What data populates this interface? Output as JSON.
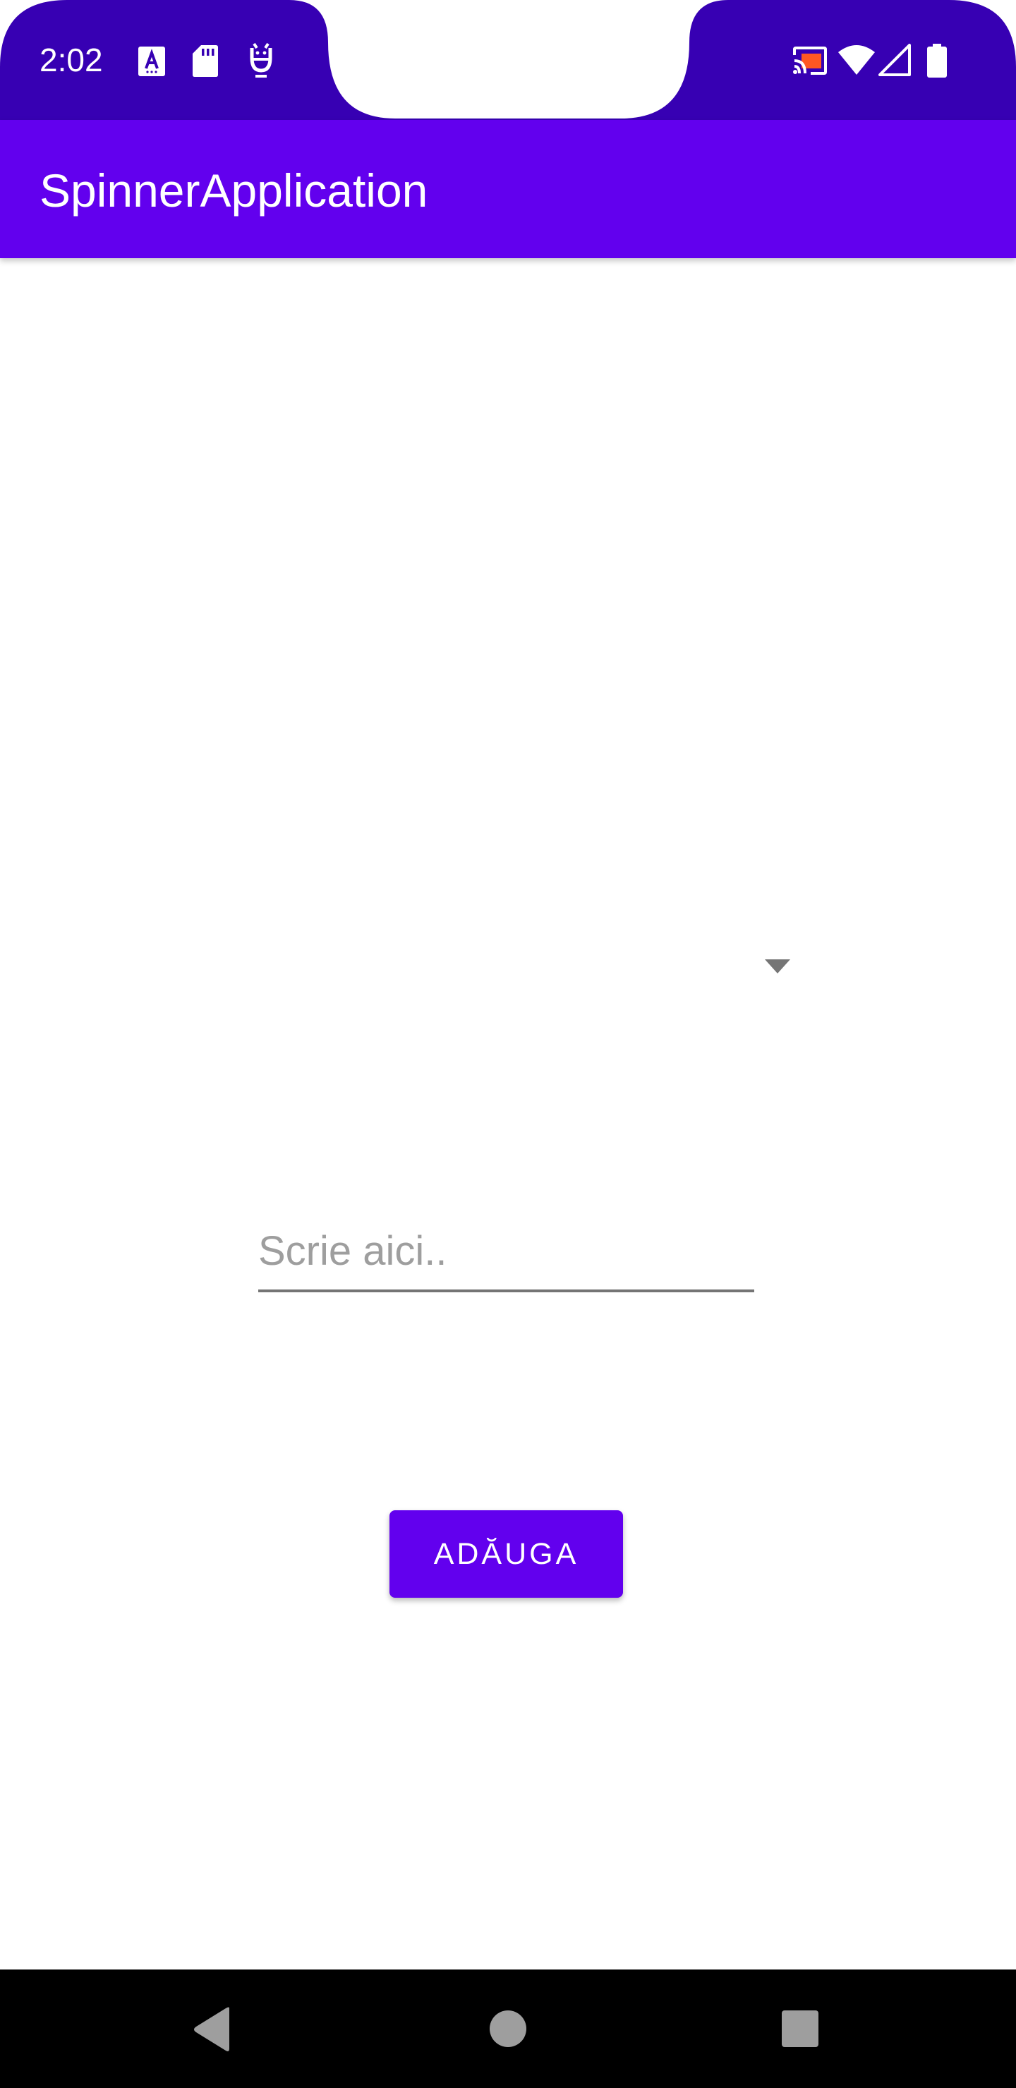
{
  "status_bar": {
    "time": "2:02",
    "left_icons": [
      "a-notification-icon",
      "sd-card-icon",
      "android-debug-icon"
    ],
    "right_icons": [
      "cast-icon",
      "wifi-icon",
      "cellular-signal-icon",
      "battery-icon"
    ],
    "background_color": "#3700b3"
  },
  "app_bar": {
    "title": "SpinnerApplication",
    "background_color": "#6200ee"
  },
  "spinner": {
    "selected_value": ""
  },
  "text_input": {
    "value": "",
    "placeholder": "Scrie aici.."
  },
  "add_button": {
    "label": "ADĂUGA",
    "background_color": "#6200ee"
  },
  "nav_bar": {
    "buttons": [
      "back-icon",
      "home-icon",
      "recents-icon"
    ],
    "background_color": "#000000"
  }
}
